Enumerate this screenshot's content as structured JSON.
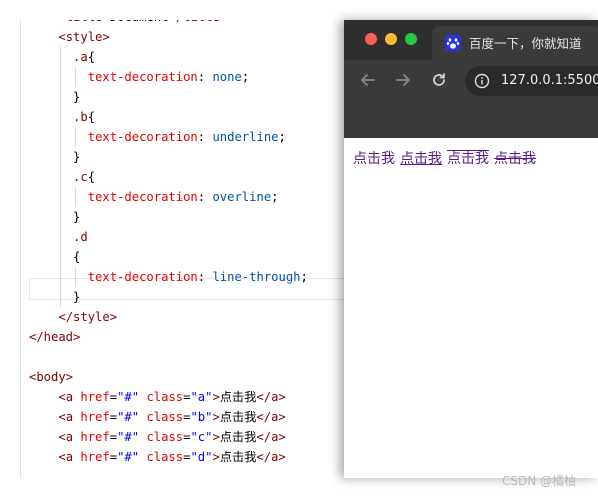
{
  "editor": {
    "lines": [
      {
        "indent": "    ",
        "tokens": [
          [
            "c-tag",
            "<title>"
          ],
          [
            "c-txt",
            "Document"
          ],
          [
            "c-tag",
            "</title>"
          ]
        ]
      },
      {
        "indent": "    ",
        "tokens": [
          [
            "c-tag",
            "<style>"
          ]
        ]
      },
      {
        "indent": "      ",
        "tokens": [
          [
            "c-sel",
            ".a"
          ],
          [
            "c-punc",
            "{"
          ]
        ]
      },
      {
        "indent": "        ",
        "tokens": [
          [
            "c-prop",
            "text-decoration"
          ],
          [
            "c-punc",
            ": "
          ],
          [
            "c-val",
            "none"
          ],
          [
            "c-punc",
            ";"
          ]
        ]
      },
      {
        "indent": "      ",
        "tokens": [
          [
            "c-punc",
            "}"
          ]
        ]
      },
      {
        "indent": "      ",
        "tokens": [
          [
            "c-sel",
            ".b"
          ],
          [
            "c-punc",
            "{"
          ]
        ]
      },
      {
        "indent": "        ",
        "tokens": [
          [
            "c-prop",
            "text-decoration"
          ],
          [
            "c-punc",
            ": "
          ],
          [
            "c-val",
            "underline"
          ],
          [
            "c-punc",
            ";"
          ]
        ]
      },
      {
        "indent": "      ",
        "tokens": [
          [
            "c-punc",
            "}"
          ]
        ]
      },
      {
        "indent": "      ",
        "tokens": [
          [
            "c-sel",
            ".c"
          ],
          [
            "c-punc",
            "{"
          ]
        ]
      },
      {
        "indent": "        ",
        "tokens": [
          [
            "c-prop",
            "text-decoration"
          ],
          [
            "c-punc",
            ": "
          ],
          [
            "c-val",
            "overline"
          ],
          [
            "c-punc",
            ";"
          ]
        ]
      },
      {
        "indent": "      ",
        "tokens": [
          [
            "c-punc",
            "}"
          ]
        ]
      },
      {
        "indent": "      ",
        "tokens": [
          [
            "c-sel",
            ".d"
          ]
        ]
      },
      {
        "indent": "      ",
        "tokens": [
          [
            "c-punc",
            "{"
          ]
        ]
      },
      {
        "indent": "        ",
        "tokens": [
          [
            "c-prop",
            "text-decoration"
          ],
          [
            "c-punc",
            ": "
          ],
          [
            "c-val",
            "line-through"
          ],
          [
            "c-punc",
            ";"
          ]
        ]
      },
      {
        "indent": "      ",
        "tokens": [
          [
            "c-punc",
            "}"
          ]
        ]
      },
      {
        "indent": "    ",
        "tokens": [
          [
            "c-tag",
            "</style>"
          ]
        ]
      },
      {
        "indent": "",
        "tokens": [
          [
            "c-tag",
            "</head>"
          ]
        ]
      },
      {
        "indent": "",
        "tokens": []
      },
      {
        "indent": "",
        "tokens": [
          [
            "c-tag",
            "<body>"
          ]
        ]
      },
      {
        "indent": "    ",
        "tokens": [
          [
            "c-tag",
            "<a "
          ],
          [
            "c-attr",
            "href"
          ],
          [
            "c-punc",
            "="
          ],
          [
            "c-str",
            "\"#\""
          ],
          [
            "c-punc",
            " "
          ],
          [
            "c-attr",
            "class"
          ],
          [
            "c-punc",
            "="
          ],
          [
            "c-str",
            "\"a\""
          ],
          [
            "c-tag",
            ">"
          ],
          [
            "c-txt",
            "点击我"
          ],
          [
            "c-tag",
            "</a>"
          ]
        ]
      },
      {
        "indent": "    ",
        "tokens": [
          [
            "c-tag",
            "<a "
          ],
          [
            "c-attr",
            "href"
          ],
          [
            "c-punc",
            "="
          ],
          [
            "c-str",
            "\"#\""
          ],
          [
            "c-punc",
            " "
          ],
          [
            "c-attr",
            "class"
          ],
          [
            "c-punc",
            "="
          ],
          [
            "c-str",
            "\"b\""
          ],
          [
            "c-tag",
            ">"
          ],
          [
            "c-txt",
            "点击我"
          ],
          [
            "c-tag",
            "</a>"
          ]
        ]
      },
      {
        "indent": "    ",
        "tokens": [
          [
            "c-tag",
            "<a "
          ],
          [
            "c-attr",
            "href"
          ],
          [
            "c-punc",
            "="
          ],
          [
            "c-str",
            "\"#\""
          ],
          [
            "c-punc",
            " "
          ],
          [
            "c-attr",
            "class"
          ],
          [
            "c-punc",
            "="
          ],
          [
            "c-str",
            "\"c\""
          ],
          [
            "c-tag",
            ">"
          ],
          [
            "c-txt",
            "点击我"
          ],
          [
            "c-tag",
            "</a>"
          ]
        ]
      },
      {
        "indent": "    ",
        "tokens": [
          [
            "c-tag",
            "<a "
          ],
          [
            "c-attr",
            "href"
          ],
          [
            "c-punc",
            "="
          ],
          [
            "c-str",
            "\"#\""
          ],
          [
            "c-punc",
            " "
          ],
          [
            "c-attr",
            "class"
          ],
          [
            "c-punc",
            "="
          ],
          [
            "c-str",
            "\"d\""
          ],
          [
            "c-tag",
            ">"
          ],
          [
            "c-txt",
            "点击我"
          ],
          [
            "c-tag",
            "</a>"
          ]
        ]
      }
    ]
  },
  "browser": {
    "tab_title": "百度一下，你就知道",
    "url": "127.0.0.1:5500",
    "links": [
      "点击我",
      "点击我",
      "点击我",
      "点击我"
    ]
  },
  "watermark": "CSDN @橘柚",
  "icons": [
    "close-dot",
    "minimize-dot",
    "maximize-dot",
    "baidu-favicon",
    "back-arrow-icon",
    "forward-arrow-icon",
    "reload-icon",
    "info-icon"
  ]
}
